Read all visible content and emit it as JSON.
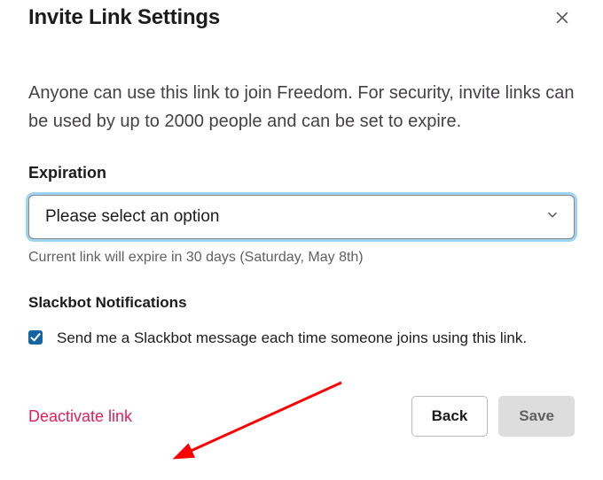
{
  "header": {
    "title": "Invite Link Settings"
  },
  "description": "Anyone can use this link to join Freedom. For security, invite links can be used by up to 2000 people and can be set to expire.",
  "expiration": {
    "label": "Expiration",
    "placeholder": "Please select an option",
    "helper": "Current link will expire in 30 days (Saturday, May 8th)"
  },
  "notifications": {
    "label": "Slackbot Notifications",
    "checkbox_label": "Send me a Slackbot message each time someone joins using this link.",
    "checked": true
  },
  "footer": {
    "deactivate": "Deactivate link",
    "back": "Back",
    "save": "Save"
  },
  "colors": {
    "danger": "#e01e5a",
    "checkbox": "#1264a3",
    "focus_ring": "#9fd4f0"
  },
  "annotation_arrow": {
    "color": "#ff0000",
    "points_to": "deactivate-link"
  }
}
